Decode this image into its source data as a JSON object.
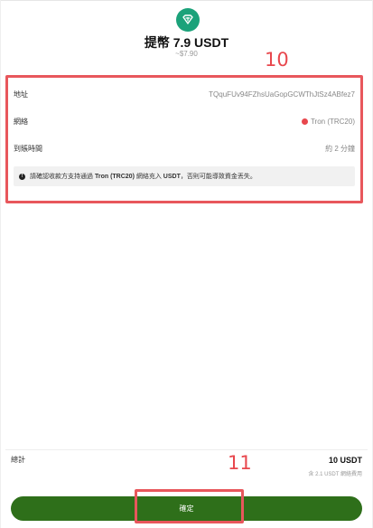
{
  "header": {
    "title": "提幣 7.9 USDT",
    "subtitle": "~$7.90",
    "coin_icon": "usdt-tether-icon"
  },
  "annotations": {
    "details_step": "10",
    "confirm_step": "11"
  },
  "details": {
    "address_label": "地址",
    "address_value": "TQquFUv94FZhsUaGopGCWThJtSz4ABfez7",
    "network_label": "網絡",
    "network_value": "Tron (TRC20)",
    "arrival_label": "到賬時間",
    "arrival_value": "約 2 分鐘",
    "warning_prefix": "請確認收款方支持通過 ",
    "warning_network": "Tron (TRC20)",
    "warning_middle": " 網絡充入 ",
    "warning_coin": "USDT",
    "warning_suffix": "，否則可能導致資金丟失。"
  },
  "summary": {
    "total_label": "總計",
    "total_value": "10 USDT",
    "fee_note": "含 2.1 USDT 網絡費用"
  },
  "actions": {
    "confirm_label": "確定"
  },
  "colors": {
    "confirm_button": "#2e6f1a",
    "annotation": "#e8474d",
    "coin": "#1ba27a"
  }
}
